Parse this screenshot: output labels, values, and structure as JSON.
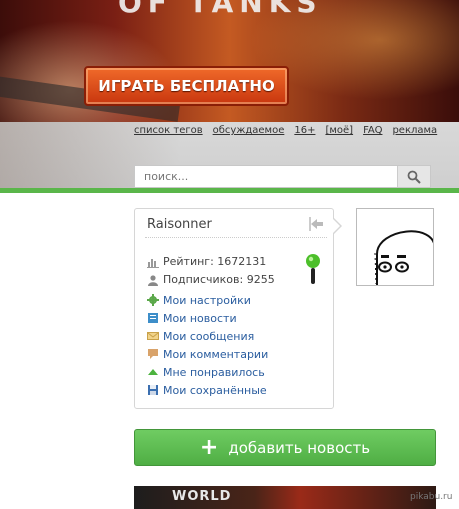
{
  "banner": {
    "logo_fragment": "OF TANKS",
    "play_label": "ИГРАТЬ БЕСПЛАТНО"
  },
  "nav_links": [
    "список тегов",
    "обсуждаемое",
    "16+",
    "[моё]",
    "FAQ",
    "реклама"
  ],
  "search": {
    "placeholder": "поиск...",
    "icon": "search-icon"
  },
  "profile": {
    "username": "Raisonner",
    "rating_label": "Рейтинг: 1672131",
    "subscribers_label": "Подписчиков: 9255",
    "menu": [
      {
        "label": "Мои настройки",
        "icon": "gear-icon"
      },
      {
        "label": "Мои новости",
        "icon": "news-icon"
      },
      {
        "label": "Мои сообщения",
        "icon": "envelope-icon"
      },
      {
        "label": "Мои комментарии",
        "icon": "comment-icon"
      },
      {
        "label": "Мне понравилось",
        "icon": "arrow-up-icon"
      },
      {
        "label": "Мои сохранённые",
        "icon": "floppy-icon"
      }
    ]
  },
  "add_post": {
    "label": "добавить новость"
  },
  "bottom_ad": {
    "text": "WORLD"
  },
  "watermark": "pikabu.ru",
  "colors": {
    "accent_green": "#5ab64a",
    "link_blue": "#2a5d9f",
    "play_orange": "#e35a1e"
  }
}
